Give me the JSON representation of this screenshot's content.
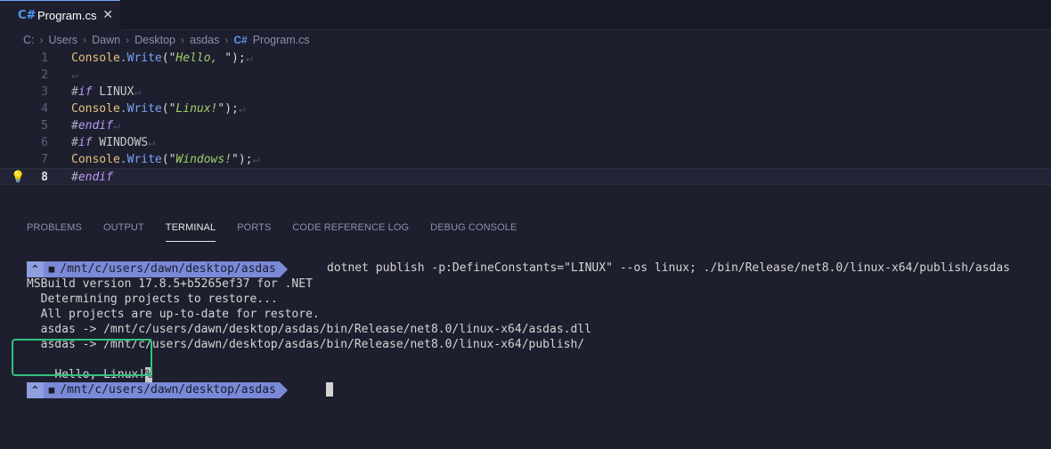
{
  "tab": {
    "icon": "C#",
    "label": "Program.cs",
    "close": "✕"
  },
  "breadcrumb": {
    "parts": [
      "C:",
      "Users",
      "Dawn",
      "Desktop",
      "asdas"
    ],
    "file_icon": "C#",
    "file": "Program.cs",
    "separator": "›"
  },
  "editor": {
    "lines": [
      {
        "n": "1",
        "kind": "write",
        "text": "Hello, "
      },
      {
        "n": "2",
        "kind": "empty"
      },
      {
        "n": "3",
        "kind": "if",
        "symbol": "LINUX"
      },
      {
        "n": "4",
        "kind": "write",
        "text": "Linux!"
      },
      {
        "n": "5",
        "kind": "endif"
      },
      {
        "n": "6",
        "kind": "if",
        "symbol": "WINDOWS"
      },
      {
        "n": "7",
        "kind": "write",
        "text": "Windows!"
      },
      {
        "n": "8",
        "kind": "endif",
        "current": true
      }
    ],
    "tokens": {
      "class": "Console",
      "dot": ".",
      "method": "Write",
      "open": "(\"",
      "close": "\");",
      "hash": "#",
      "if": "if",
      "endif": "endif",
      "eol": "↵"
    }
  },
  "panel": {
    "tabs": [
      "PROBLEMS",
      "OUTPUT",
      "TERMINAL",
      "PORTS",
      "CODE REFERENCE LOG",
      "DEBUG CONSOLE"
    ],
    "active": "TERMINAL"
  },
  "terminal": {
    "prompt_symbol": "^",
    "prompt_path": "/mnt/c/users/dawn/desktop/asdas",
    "command": "dotnet publish -p:DefineConstants=\"LINUX\" --os linux; ./bin/Release/net8.0/linux-x64/publish/asdas",
    "output": [
      "MSBuild version 17.8.5+b5265ef37 for .NET",
      "  Determining projects to restore...",
      "  All projects are up-to-date for restore.",
      "  asdas -> /mnt/c/users/dawn/desktop/asdas/bin/Release/net8.0/linux-x64/asdas.dll",
      "  asdas -> /mnt/c/users/dawn/desktop/asdas/bin/Release/net8.0/linux-x64/publish/"
    ],
    "result": "Hello, Linux!",
    "result_cursor": "%"
  },
  "colors": {
    "background": "#1e1f2e",
    "highlight": "#2fc37e",
    "prompt": "#7a8ad8"
  }
}
